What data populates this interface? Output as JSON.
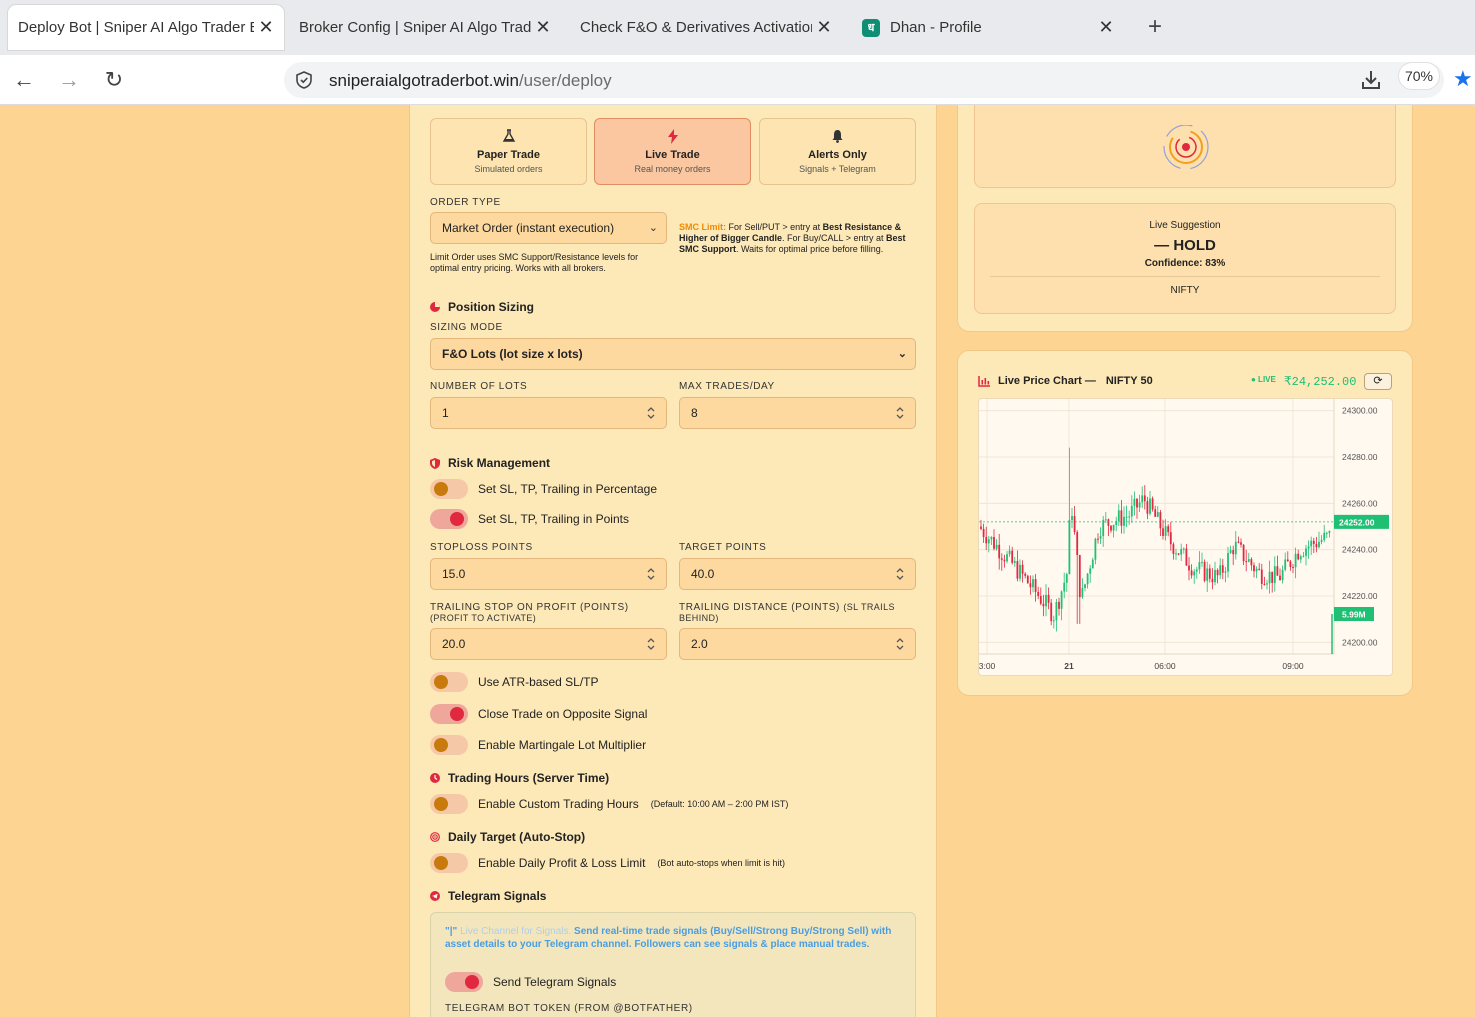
{
  "browser": {
    "tabs": [
      {
        "title": "Deploy Bot | Sniper AI Algo Trader B",
        "active": true
      },
      {
        "title": "Broker Config | Sniper AI Algo Trade",
        "active": false
      },
      {
        "title": "Check F&O & Derivatives Activation",
        "active": false
      },
      {
        "title": "Dhan - Profile",
        "active": false,
        "favicon": "ध"
      }
    ],
    "url_host": "sniperaialgotraderbot.win",
    "url_path": "/user/deploy",
    "zoom": "70%"
  },
  "trade_modes": [
    {
      "icon": "flask-icon",
      "title": "Paper Trade",
      "subtitle": "Simulated orders",
      "active": false
    },
    {
      "icon": "bolt-icon",
      "title": "Live Trade",
      "subtitle": "Real money orders",
      "active": true
    },
    {
      "icon": "bell-icon",
      "title": "Alerts Only",
      "subtitle": "Signals + Telegram",
      "active": false
    }
  ],
  "order": {
    "label": "ORDER TYPE",
    "value": "Market Order (instant execution)",
    "note": "Limit Order uses SMC Support/Resistance levels for optimal entry pricing. Works with all brokers.",
    "smc_title": "SMC Limit:",
    "smc_1": " For Sell/PUT > entry at ",
    "smc_2": "Best Resistance & Higher of Bigger Candle",
    "smc_3": ". For Buy/CALL > entry at ",
    "smc_4": "Best SMC Support",
    "smc_5": ". Waits for optimal price before filling."
  },
  "position": {
    "title": "Position Sizing",
    "mode_label": "SIZING MODE",
    "mode_value": "F&O Lots (lot size x lots)",
    "lots_label": "NUMBER OF LOTS",
    "lots_value": "1",
    "max_label": "MAX TRADES/DAY",
    "max_value": "8"
  },
  "risk": {
    "title": "Risk Management",
    "toggle_pct": "Set SL, TP, Trailing in Percentage",
    "toggle_pts": "Set SL, TP, Trailing in Points",
    "sl_label": "STOPLOSS POINTS",
    "sl_value": "15.0",
    "tp_label": "TARGET POINTS",
    "tp_value": "40.0",
    "trail_label": "TRAILING STOP ON PROFIT (POINTS)",
    "trail_sub": "(PROFIT TO ACTIVATE)",
    "trail_value": "20.0",
    "dist_label": "TRAILING DISTANCE (POINTS)",
    "dist_sub": "(SL TRAILS BEHIND)",
    "dist_value": "2.0",
    "atr": "Use ATR-based SL/TP",
    "opposite": "Close Trade on Opposite Signal",
    "martingale": "Enable Martingale Lot Multiplier"
  },
  "hours": {
    "title": "Trading Hours (Server Time)",
    "toggle": "Enable Custom Trading Hours",
    "hint": "(Default: 10:00 AM – 2:00 PM IST)"
  },
  "daily": {
    "title": "Daily Target (Auto-Stop)",
    "toggle": "Enable Daily Profit & Loss Limit",
    "hint": "(Bot auto-stops when limit is hit)"
  },
  "telegram": {
    "title": "Telegram Signals",
    "faint": "Live Channel for Signals.",
    "text": "Send real-time trade signals (Buy/Sell/Strong Buy/Strong Sell) with asset details to your Telegram channel. Followers can see signals & place manual trades.",
    "toggle": "Send Telegram Signals",
    "token_label": "TELEGRAM BOT TOKEN (FROM @BOTFATHER)"
  },
  "suggestion": {
    "label": "Live Suggestion",
    "value": "— HOLD",
    "confidence": "Confidence: 83%",
    "symbol": "NIFTY"
  },
  "chart": {
    "title": "Live Price Chart —",
    "symbol": "NIFTY 50",
    "live": "● LIVE",
    "price": "₹24,252.00",
    "current_tag": "24252.00",
    "volume_tag": "5.99M"
  },
  "chart_data": {
    "type": "candlestick",
    "ylim": [
      24195,
      24305
    ],
    "y_ticks": [
      "24300.00",
      "24280.00",
      "24260.00",
      "24240.00",
      "24220.00",
      "24200.00"
    ],
    "x_ticks": [
      "3:00",
      "21",
      "06:00",
      "09:00"
    ],
    "current_price": 24252.0,
    "volume": "5.99M"
  },
  "colors": {
    "up": "#1fbf74",
    "down": "#e0283f",
    "accent": "#f08a00"
  }
}
